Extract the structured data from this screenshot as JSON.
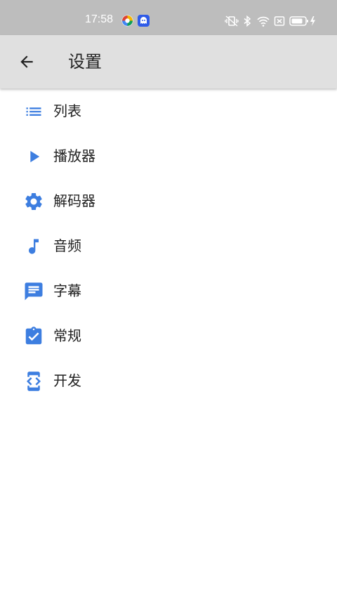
{
  "status_bar": {
    "time": "17:58"
  },
  "toolbar": {
    "title": "设置"
  },
  "menu": {
    "items": [
      {
        "label": "列表",
        "icon": "list-icon"
      },
      {
        "label": "播放器",
        "icon": "play-icon"
      },
      {
        "label": "解码器",
        "icon": "gear-icon"
      },
      {
        "label": "音频",
        "icon": "music-note-icon"
      },
      {
        "label": "字幕",
        "icon": "subtitle-icon"
      },
      {
        "label": "常规",
        "icon": "clipboard-check-icon"
      },
      {
        "label": "开发",
        "icon": "developer-mode-icon"
      }
    ]
  },
  "colors": {
    "accent": "#3d7ee0",
    "toolbar_bg": "#e0e0e0",
    "status_bar_bg": "#bdbdbd",
    "text": "#212121"
  }
}
